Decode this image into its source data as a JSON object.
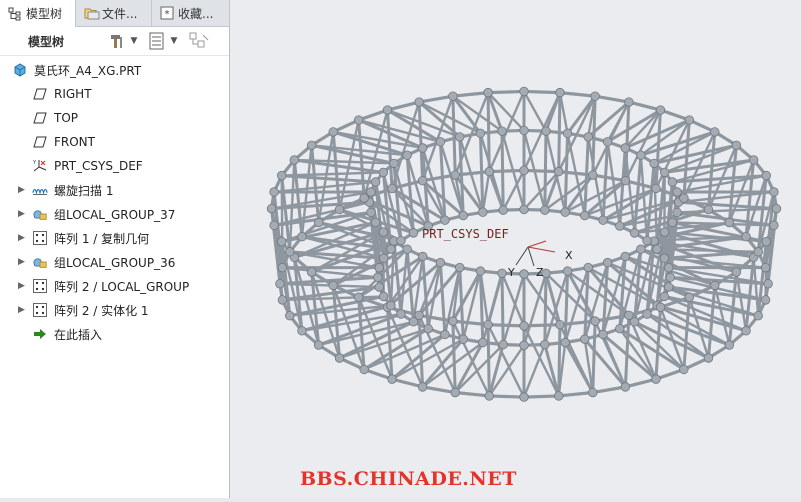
{
  "tabs": [
    {
      "label": "模型树",
      "icon": "model-tree-icon"
    },
    {
      "label": "文件...",
      "icon": "folder-icon"
    },
    {
      "label": "收藏...",
      "icon": "favorites-icon"
    }
  ],
  "toolbar": {
    "label": "模型树"
  },
  "tree": {
    "root": "莫氏环_A4_XG.PRT",
    "items": [
      {
        "label": "RIGHT",
        "icon": "datum-plane-icon",
        "expandable": false
      },
      {
        "label": "TOP",
        "icon": "datum-plane-icon",
        "expandable": false
      },
      {
        "label": "FRONT",
        "icon": "datum-plane-icon",
        "expandable": false
      },
      {
        "label": "PRT_CSYS_DEF",
        "icon": "csys-icon",
        "expandable": false
      },
      {
        "label": "螺旋扫描 1",
        "icon": "helical-sweep-icon",
        "expandable": true
      },
      {
        "label": "组LOCAL_GROUP_37",
        "icon": "group-icon",
        "expandable": true
      },
      {
        "label": "阵列 1 / 复制几何",
        "icon": "pattern-icon",
        "expandable": true
      },
      {
        "label": "组LOCAL_GROUP_36",
        "icon": "group-icon",
        "expandable": true
      },
      {
        "label": "阵列 2 / LOCAL_GROUP",
        "icon": "pattern-icon",
        "expandable": true
      },
      {
        "label": "阵列 2 / 实体化 1",
        "icon": "pattern-icon",
        "expandable": true
      },
      {
        "label": "在此插入",
        "icon": "insert-here-icon",
        "expandable": false
      }
    ]
  },
  "viewport": {
    "csys_label": "PRT_CSYS_DEF",
    "axes": {
      "x": "X",
      "y": "Y",
      "z": "Z"
    }
  },
  "watermark": "BBS.CHINADE.NET",
  "colors": {
    "wire": "#8e969f",
    "insert_arrow": "#2b8a1e",
    "watermark": "#e4332b"
  }
}
